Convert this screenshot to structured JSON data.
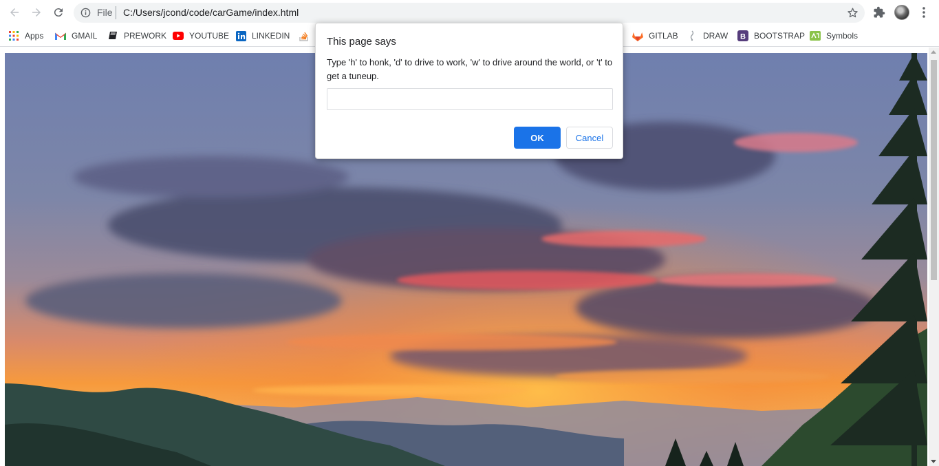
{
  "browser": {
    "address_scheme": "File",
    "address_url": "C:/Users/jcond/code/carGame/index.html"
  },
  "bookmarks": [
    {
      "label": "Apps",
      "icon": "apps-grid-icon"
    },
    {
      "label": "GMAIL",
      "icon": "gmail-icon"
    },
    {
      "label": "PREWORK",
      "icon": "book-icon"
    },
    {
      "label": "YOUTUBE",
      "icon": "youtube-icon"
    },
    {
      "label": "LINKEDIN",
      "icon": "linkedin-icon"
    },
    {
      "label": "",
      "icon": "stackoverflow-icon"
    },
    {
      "label": "GITLAB",
      "icon": "gitlab-icon"
    },
    {
      "label": "DRAW",
      "icon": "draw-icon"
    },
    {
      "label": "BOOTSTRAP",
      "icon": "bootstrap-icon"
    },
    {
      "label": "Symbols",
      "icon": "symbols-icon"
    }
  ],
  "dialog": {
    "title": "This page says",
    "message": "Type 'h' to honk, 'd' to drive to work, 'w' to drive around the world, or 't' to get a tuneup.",
    "input_value": "",
    "ok_label": "OK",
    "cancel_label": "Cancel"
  },
  "colors": {
    "accent": "#1a73e8",
    "sky_top": "#6f7fae",
    "sunset": "#f79a3c"
  }
}
